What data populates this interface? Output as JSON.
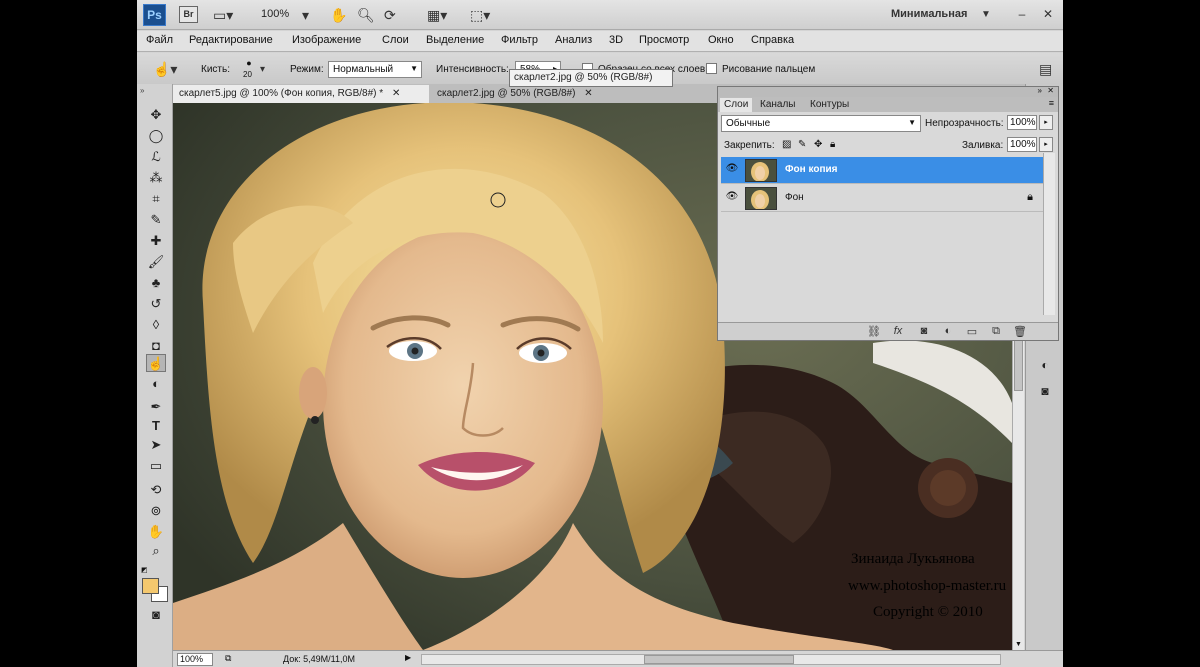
{
  "appbar": {
    "ps_label": "Ps",
    "br_label": "Br",
    "zoom": "100%",
    "workspace": "Минимальная"
  },
  "menu": [
    "Файл",
    "Редактирование",
    "Изображение",
    "Слои",
    "Выделение",
    "Фильтр",
    "Анализ",
    "3D",
    "Просмотр",
    "Окно",
    "Справка"
  ],
  "options": {
    "brush_label": "Кисть:",
    "brush_size": "20",
    "mode_label": "Режим:",
    "mode_value": "Нормальный",
    "strength_label": "Интенсивность:",
    "strength_value": "58%",
    "sample_all": "Образец со всех слоев",
    "finger_painting": "Рисование пальцем"
  },
  "tooltip": "скарлет2.jpg @ 50% (RGB/8#)",
  "document_tabs": [
    {
      "label": "скарлет5.jpg @ 100% (Фон копия, RGB/8#) *",
      "active": true
    },
    {
      "label": "скарлет2.jpg @ 50% (RGB/8#)",
      "active": false
    }
  ],
  "colors": {
    "foreground": "#f4c86e",
    "background": "#ffffff",
    "layer_selected": "#3a8ee6"
  },
  "layers_panel": {
    "tabs": [
      "Слои",
      "Каналы",
      "Контуры"
    ],
    "blend_mode": "Обычные",
    "opacity_label": "Непрозрачность:",
    "opacity_value": "100%",
    "lock_label": "Закрепить:",
    "fill_label": "Заливка:",
    "fill_value": "100%",
    "layers": [
      {
        "name": "Фон копия",
        "selected": true,
        "locked": false
      },
      {
        "name": "Фон",
        "selected": false,
        "locked": true
      }
    ]
  },
  "status": {
    "zoom": "100%",
    "doc_info": "Док: 5,49M/11,0M"
  },
  "watermark": {
    "author": "Зинаида Лукьянова",
    "site": "www.photoshop-master.ru",
    "copyright": "Copyright © 2010"
  },
  "icons": [
    "move-icon",
    "marquee-icon",
    "lasso-icon",
    "magic-wand-icon",
    "crop-icon",
    "eyedropper-icon",
    "healing-brush-icon",
    "brush-icon",
    "clone-stamp-icon",
    "history-brush-icon",
    "eraser-icon",
    "paint-bucket-icon",
    "smudge-icon",
    "dodge-icon",
    "pen-icon",
    "type-icon",
    "path-selection-icon",
    "rectangle-icon",
    "3d-rotate-icon",
    "3d-orbit-icon",
    "hand-icon",
    "zoom-icon",
    "quick-mask-icon"
  ]
}
